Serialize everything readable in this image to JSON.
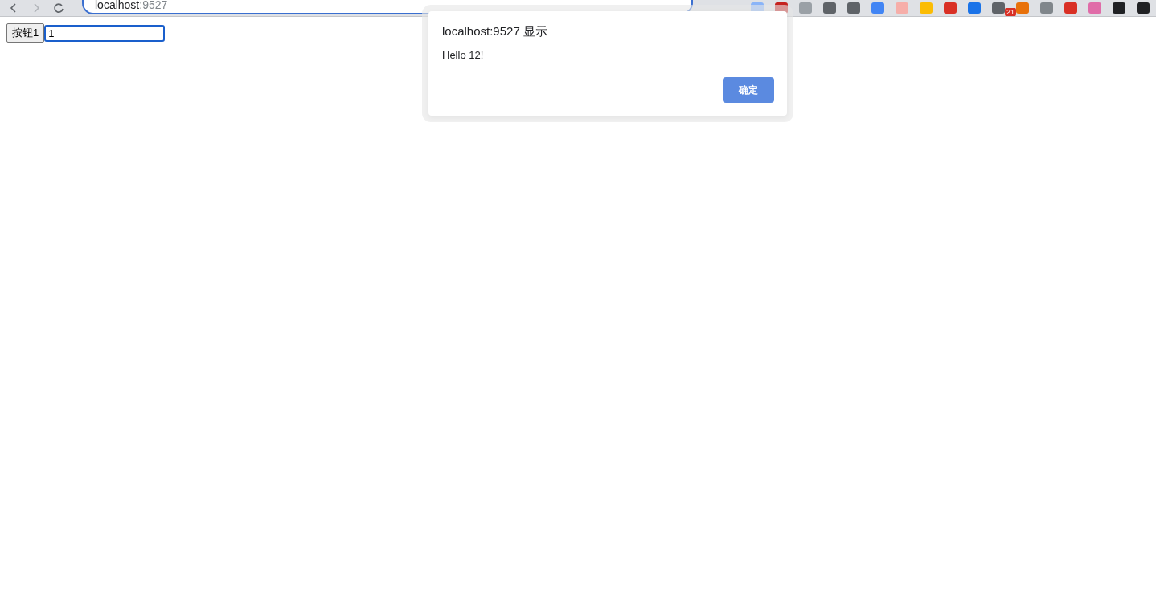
{
  "browser": {
    "address": {
      "host": "localhost",
      "port": ":9527"
    },
    "extension_badge": "21"
  },
  "page": {
    "button": "按钮1",
    "input": {
      "value": "1",
      "focused": true
    }
  },
  "dialog": {
    "title": "localhost:9527 显示",
    "message": "Hello 12!",
    "buttons": [
      "确定"
    ]
  }
}
